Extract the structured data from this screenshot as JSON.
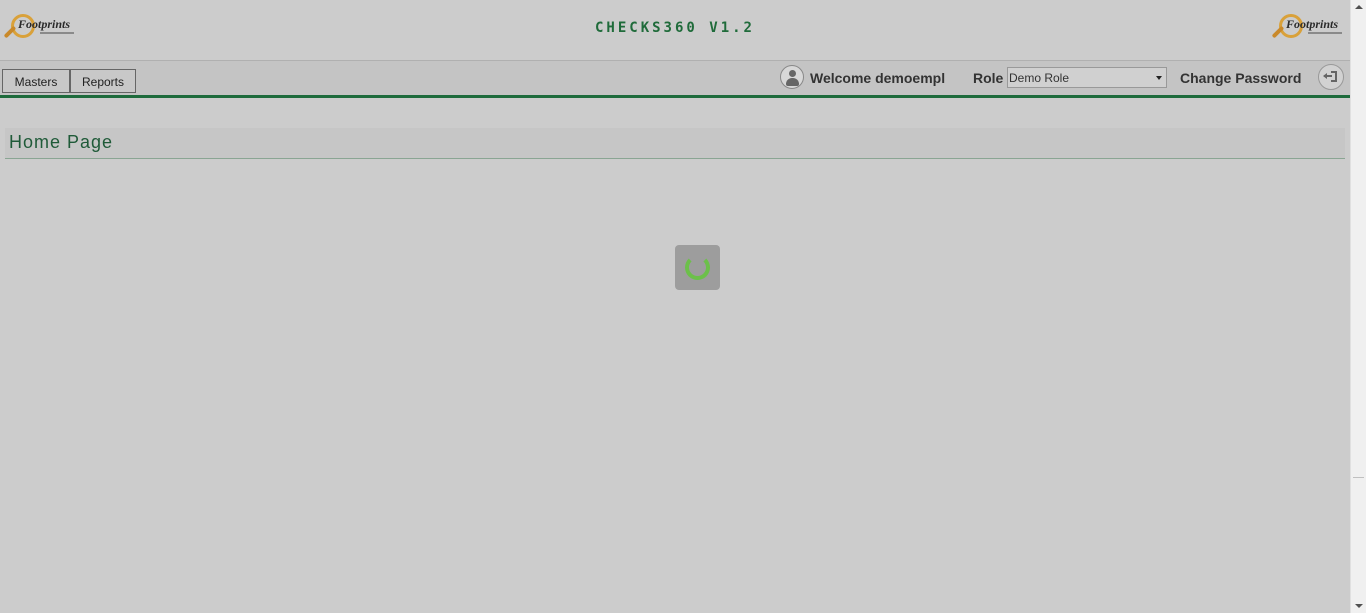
{
  "header": {
    "app_title": "CHECKS360 V1.2",
    "logo_left_text": "Footprints",
    "logo_right_text": "Footprints"
  },
  "nav": {
    "tabs": [
      {
        "label": "Masters"
      },
      {
        "label": "Reports"
      }
    ]
  },
  "user": {
    "welcome_text": "Welcome demoempl",
    "role_label": "Role",
    "role_value": "Demo Role",
    "change_password_label": "Change Password",
    "avatar_icon": "user-icon",
    "logout_icon": "logout-icon"
  },
  "main": {
    "page_title": "Home Page",
    "loading_icon": "spinner-icon"
  },
  "colors": {
    "background": "#cccccc",
    "accent_green": "#1e6b3c",
    "title_green": "#1f6b3a",
    "spinner_green": "#6cc04a"
  }
}
